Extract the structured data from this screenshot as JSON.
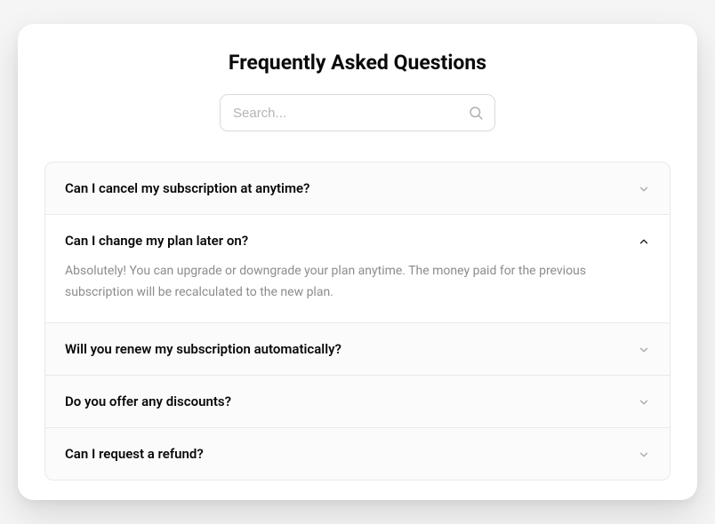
{
  "title": "Frequently Asked Questions",
  "search": {
    "placeholder": "Search..."
  },
  "faq": [
    {
      "question": "Can I cancel my subscription at anytime?",
      "answer": "",
      "expanded": false
    },
    {
      "question": "Can I change my plan later on?",
      "answer": "Absolutely! You can upgrade or downgrade your plan anytime. The money paid for the previous subscription will be recalculated to the new plan.",
      "expanded": true
    },
    {
      "question": "Will you renew my subscription automatically?",
      "answer": "",
      "expanded": false
    },
    {
      "question": "Do you offer any discounts?",
      "answer": "",
      "expanded": false
    },
    {
      "question": "Can I request a refund?",
      "answer": "",
      "expanded": false
    }
  ]
}
